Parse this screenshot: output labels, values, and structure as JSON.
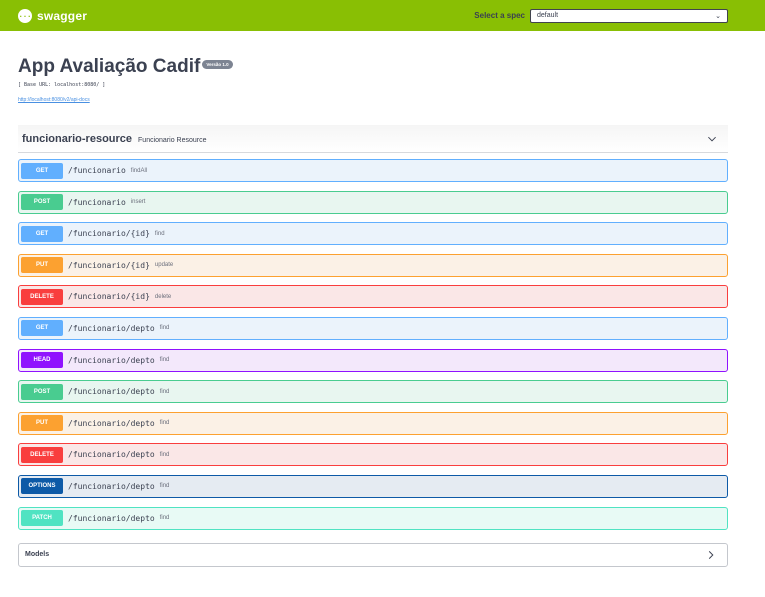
{
  "topbar": {
    "logo_glyph": "{...}",
    "brand": "swagger",
    "spec_label": "Select a spec",
    "spec_value": "default"
  },
  "info": {
    "title": "App Avaliação Cadif",
    "version": "Versão 1.0",
    "base_url": "[ Base URL: localhost:8080/ ]",
    "docs_link": "http://localhost:8080/v2/api-docs"
  },
  "tag": {
    "name": "funcionario-resource",
    "description": "Funcionario Resource"
  },
  "operations": [
    {
      "method": "GET",
      "path": "/funcionario",
      "summary": "findAll"
    },
    {
      "method": "POST",
      "path": "/funcionario",
      "summary": "insert"
    },
    {
      "method": "GET",
      "path": "/funcionario/{id}",
      "summary": "find"
    },
    {
      "method": "PUT",
      "path": "/funcionario/{id}",
      "summary": "update"
    },
    {
      "method": "DELETE",
      "path": "/funcionario/{id}",
      "summary": "delete"
    },
    {
      "method": "GET",
      "path": "/funcionario/depto",
      "summary": "find"
    },
    {
      "method": "HEAD",
      "path": "/funcionario/depto",
      "summary": "find"
    },
    {
      "method": "POST",
      "path": "/funcionario/depto",
      "summary": "find"
    },
    {
      "method": "PUT",
      "path": "/funcionario/depto",
      "summary": "find"
    },
    {
      "method": "DELETE",
      "path": "/funcionario/depto",
      "summary": "find"
    },
    {
      "method": "OPTIONS",
      "path": "/funcionario/depto",
      "summary": "find"
    },
    {
      "method": "PATCH",
      "path": "/funcionario/depto",
      "summary": "find"
    }
  ],
  "models": {
    "title": "Models"
  },
  "colors": {
    "topbar": "#89bf04",
    "get": "#61affe",
    "post": "#49cc90",
    "put": "#fca130",
    "delete": "#f93e3e",
    "head": "#9012fe",
    "options": "#0d5aa7",
    "patch": "#50e3c2"
  },
  "icons": {
    "logo": "swagger-logo-icon",
    "spec_dropdown": "chevron-down-icon",
    "tag_toggle": "chevron-down-icon",
    "models_toggle": "chevron-right-icon"
  }
}
